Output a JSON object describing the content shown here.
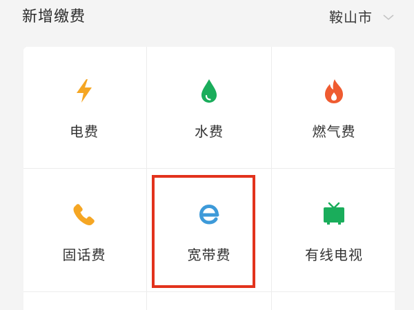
{
  "header": {
    "title": "新增缴费",
    "city": "鞍山市"
  },
  "colors": {
    "electricity_icon": "#f5a623",
    "water_icon": "#1aad5b",
    "gas_icon": "#ef5b30",
    "phone_icon": "#f5a623",
    "broadband_icon": "#3d9ad9",
    "tv_icon": "#1aad5b",
    "highlight_border": "#e2321c"
  },
  "services": [
    {
      "label": "电费",
      "icon": "lightning-icon"
    },
    {
      "label": "水费",
      "icon": "water-drop-icon"
    },
    {
      "label": "燃气费",
      "icon": "flame-icon"
    },
    {
      "label": "固话费",
      "icon": "phone-icon"
    },
    {
      "label": "宽带费",
      "icon": "broadband-e-icon"
    },
    {
      "label": "有线电视",
      "icon": "tv-icon"
    }
  ]
}
